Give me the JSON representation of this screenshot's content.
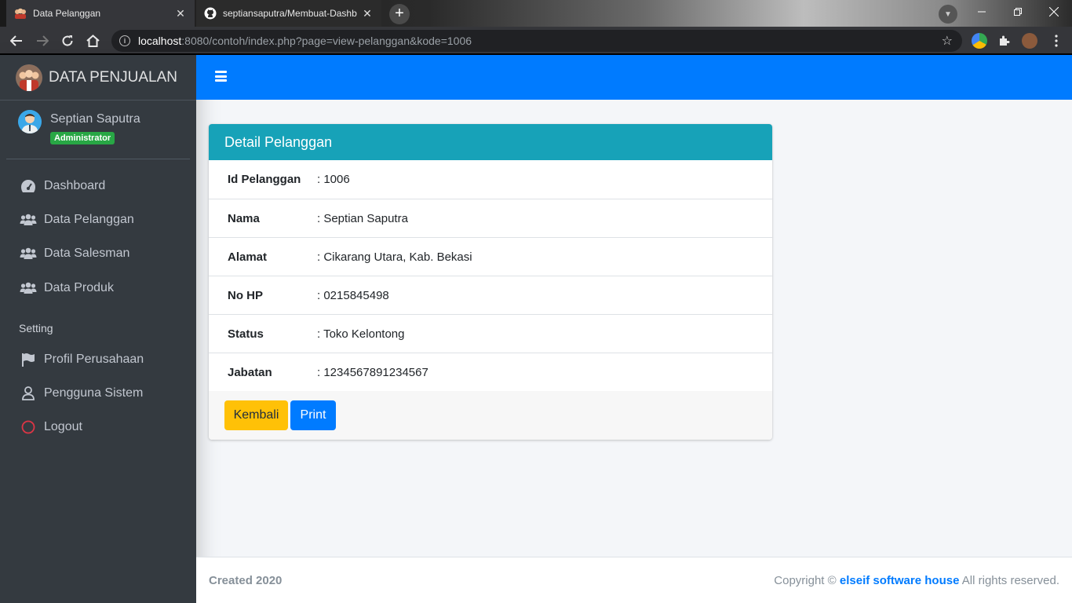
{
  "browser": {
    "tabs": [
      {
        "title": "Data Pelanggan",
        "close": "✕"
      },
      {
        "title": "septiansaputra/Membuat-Dashb",
        "close": "✕"
      }
    ],
    "new_tab": "+",
    "url_host": "localhost",
    "url_rest": ":8080/contoh/index.php?page=view-pelanggan&kode=1006"
  },
  "sidebar": {
    "brand": "DATA PENJUALAN",
    "user_name": "Septian Saputra",
    "user_role": "Administrator",
    "items": [
      {
        "label": "Dashboard",
        "icon": "tachometer-icon"
      },
      {
        "label": "Data Pelanggan",
        "icon": "users-icon"
      },
      {
        "label": "Data Salesman",
        "icon": "users-icon"
      },
      {
        "label": "Data Produk",
        "icon": "users-icon"
      }
    ],
    "section_header": "Setting",
    "setting_items": [
      {
        "label": "Profil Perusahaan",
        "icon": "flag-icon"
      },
      {
        "label": "Pengguna Sistem",
        "icon": "user-icon"
      },
      {
        "label": "Logout",
        "icon": "circle-icon"
      }
    ]
  },
  "card": {
    "title": "Detail Pelanggan",
    "rows": [
      {
        "label": "Id Pelanggan",
        "value": ": 1006"
      },
      {
        "label": "Nama",
        "value": ": Septian Saputra"
      },
      {
        "label": "Alamat",
        "value": ": Cikarang Utara, Kab. Bekasi"
      },
      {
        "label": "No HP",
        "value": ": 0215845498"
      },
      {
        "label": "Status",
        "value": ": Toko Kelontong"
      },
      {
        "label": "Jabatan",
        "value": ": 1234567891234567"
      }
    ],
    "back_label": "Kembali",
    "print_label": "Print"
  },
  "footer": {
    "created": "Created 2020",
    "copyright_prefix": "Copyright ©",
    "company": "elseif software house",
    "copyright_suffix": "All rights reserved."
  },
  "colors": {
    "sidebar_bg": "#343a40",
    "topnav_bg": "#007bff",
    "card_header_bg": "#17a2b8",
    "badge_bg": "#28a745",
    "btn_warning": "#ffc107",
    "btn_primary": "#007bff",
    "logout_icon": "#dc3545"
  }
}
